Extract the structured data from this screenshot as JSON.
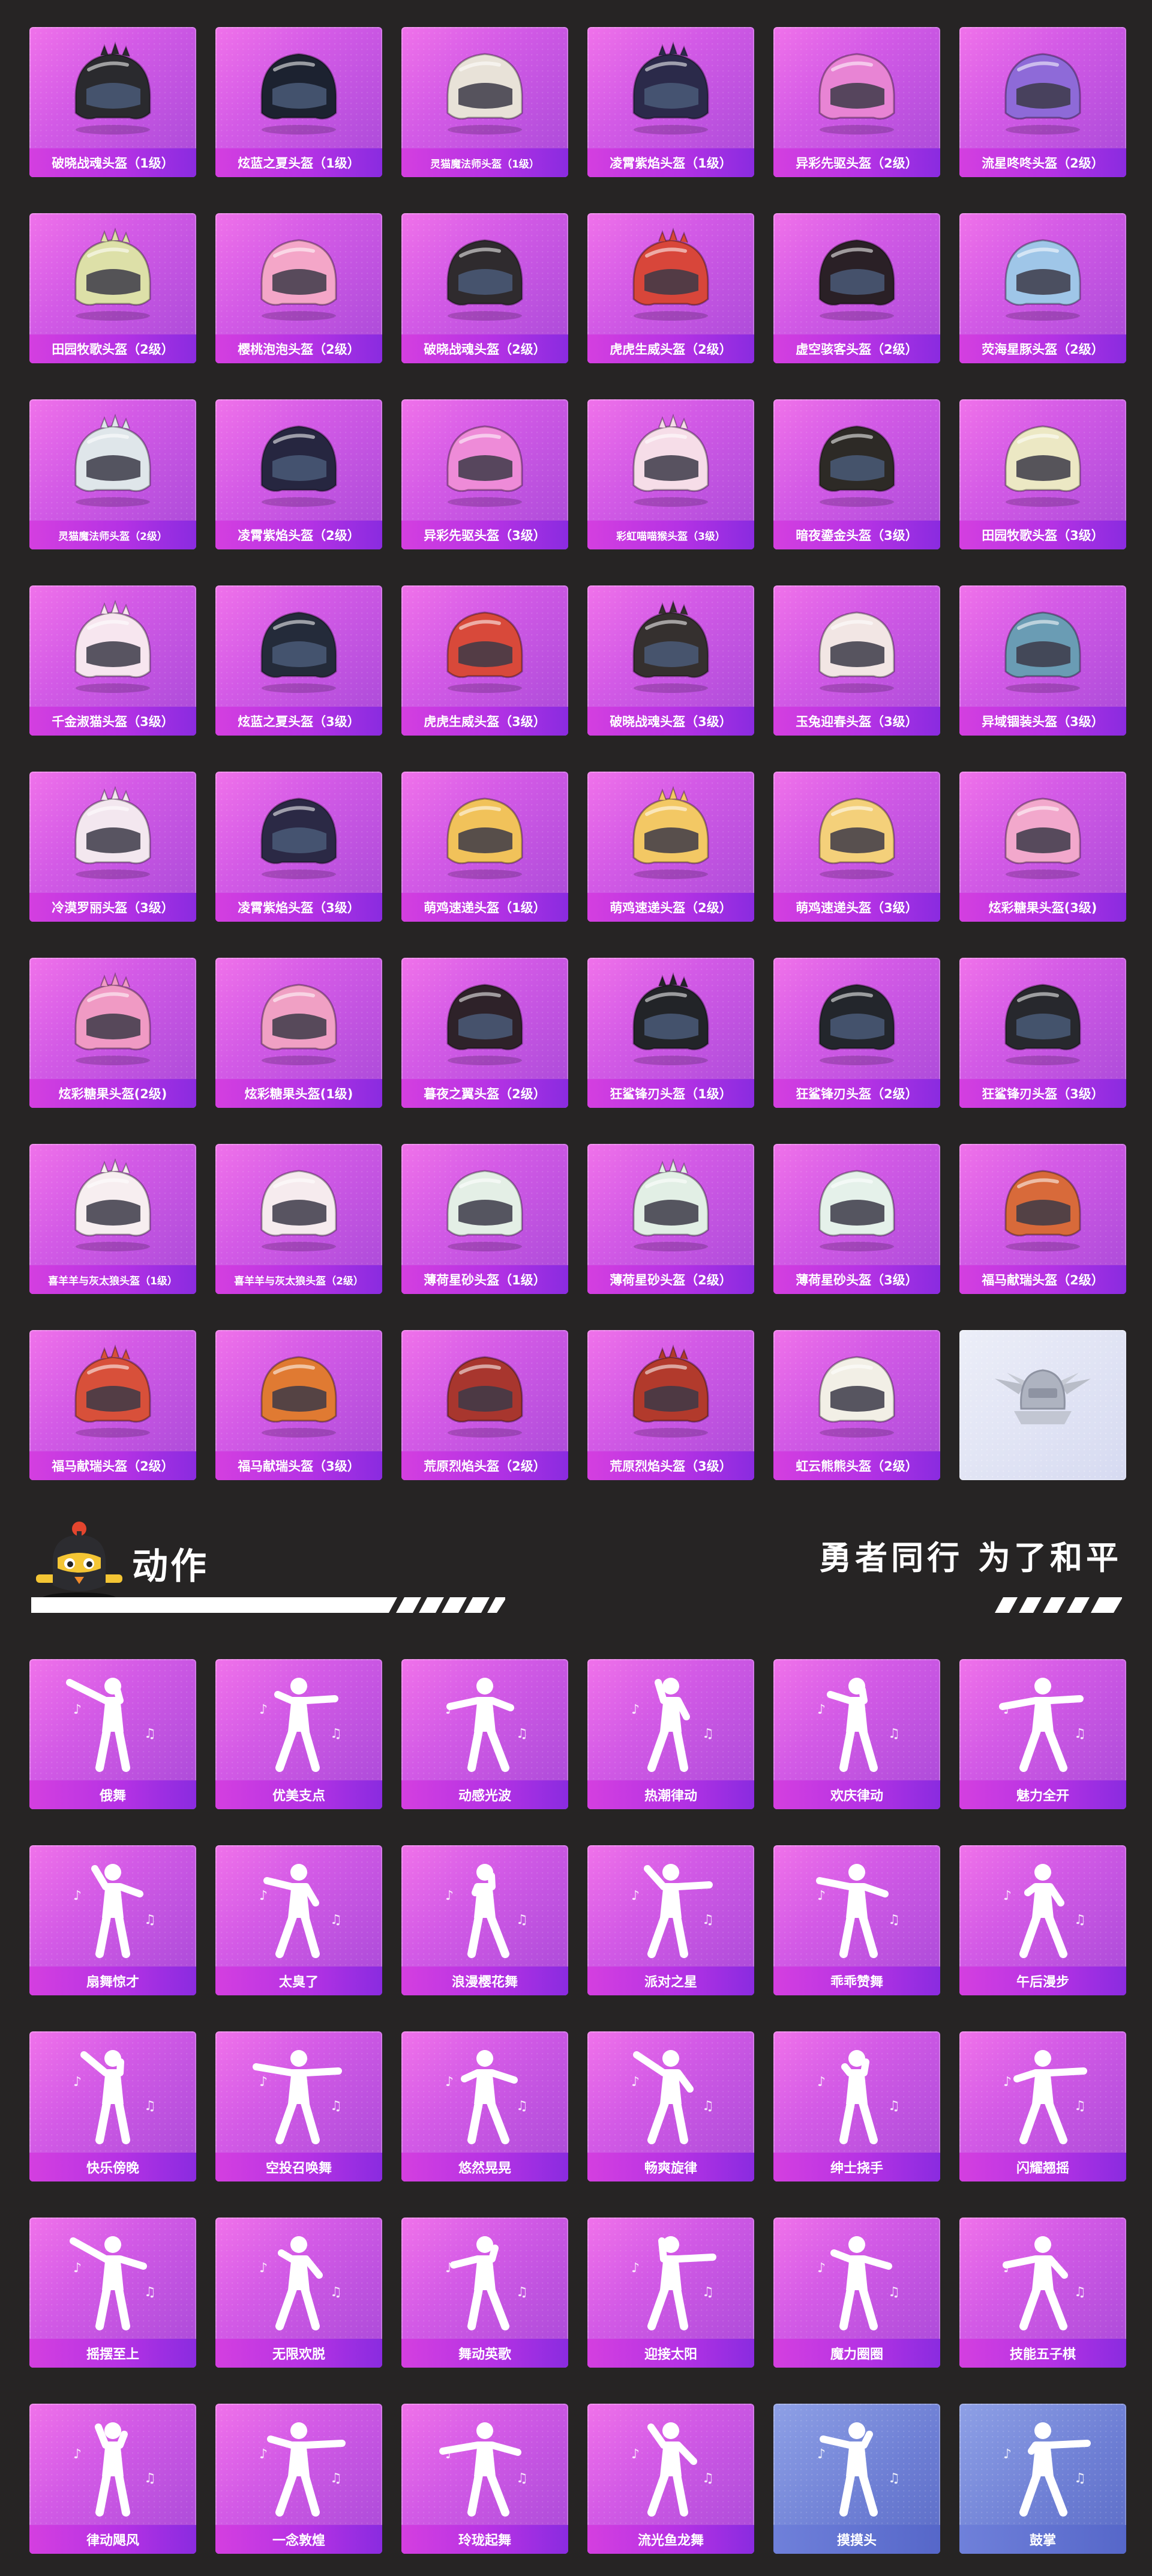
{
  "helmets": [
    {
      "label": "破晓战魂头盔（1级）",
      "color": "#2a2a2e"
    },
    {
      "label": "炫蓝之夏头盔（1级）",
      "color": "#1c2230"
    },
    {
      "label": "灵猫魔法师头盔（1级）",
      "color": "#e8e2d8"
    },
    {
      "label": "凌霄紫焰头盔（1级）",
      "color": "#2b2a4a"
    },
    {
      "label": "异彩先驱头盔（2级）",
      "color": "#e884d4"
    },
    {
      "label": "流星咚咚头盔（2级）",
      "color": "#8e6ad8"
    },
    {
      "label": "田园牧歌头盔（2级）",
      "color": "#dde0a8"
    },
    {
      "label": "樱桃泡泡头盔（2级）",
      "color": "#f4a6c8"
    },
    {
      "label": "破晓战魂头盔（2级）",
      "color": "#2f2b2e"
    },
    {
      "label": "虎虎生威头盔（2级）",
      "color": "#d8463a"
    },
    {
      "label": "虚空骇客头盔（2级）",
      "color": "#2a2026"
    },
    {
      "label": "荧海星豚头盔（2级）",
      "color": "#9fc6e8"
    },
    {
      "label": "灵猫魔法师头盔（2级）",
      "color": "#dfe6ea"
    },
    {
      "label": "凌霄紫焰头盔（2级）",
      "color": "#262640"
    },
    {
      "label": "异彩先驱头盔（3级）",
      "color": "#ee8bd8"
    },
    {
      "label": "彩虹喵喵猴头盔（3级）",
      "color": "#f6dde8"
    },
    {
      "label": "暗夜鎏金头盔（3级）",
      "color": "#2d2a26"
    },
    {
      "label": "田园牧歌头盔（3级）",
      "color": "#ece8c4"
    },
    {
      "label": "千金淑猫头盔（3级）",
      "color": "#f7e6ef"
    },
    {
      "label": "炫蓝之夏头盔（3级）",
      "color": "#242b3a"
    },
    {
      "label": "虎虎生威头盔（3级）",
      "color": "#d8493a"
    },
    {
      "label": "破晓战魂头盔（3级）",
      "color": "#35302f"
    },
    {
      "label": "玉兔迎春头盔（3级）",
      "color": "#f2e6e4"
    },
    {
      "label": "异域锢装头盔（3级）",
      "color": "#6a9cb4"
    },
    {
      "label": "冷漠罗丽头盔（3级）",
      "color": "#f3e7ef"
    },
    {
      "label": "凌霄紫焰头盔（3级）",
      "color": "#2b2945"
    },
    {
      "label": "萌鸡速递头盔（1级）",
      "color": "#f1c25a"
    },
    {
      "label": "萌鸡速递头盔（2级）",
      "color": "#f3c864"
    },
    {
      "label": "萌鸡速递头盔（3级）",
      "color": "#f4d07a"
    },
    {
      "label": "炫彩糖果头盔(3级)",
      "color": "#f2a8cc"
    },
    {
      "label": "炫彩糖果头盔(2级)",
      "color": "#f09ac4"
    },
    {
      "label": "炫彩糖果头盔(1级)",
      "color": "#f0a0c4"
    },
    {
      "label": "暮夜之翼头盔（2级）",
      "color": "#2e2229"
    },
    {
      "label": "狂鲨锋刃头盔（1级）",
      "color": "#222428"
    },
    {
      "label": "狂鲨锋刃头盔（2级）",
      "color": "#23262c"
    },
    {
      "label": "狂鲨锋刃头盔（3级）",
      "color": "#27282d"
    },
    {
      "label": "喜羊羊与灰太狼头盔（1级）",
      "color": "#f7eef0"
    },
    {
      "label": "喜羊羊与灰太狼头盔（2级）",
      "color": "#f6ebee"
    },
    {
      "label": "薄荷星砂头盔（1级）",
      "color": "#e4efe6"
    },
    {
      "label": "薄荷星砂头盔（2级）",
      "color": "#e2efe5"
    },
    {
      "label": "薄荷星砂头盔（3级）",
      "color": "#e5f1ea"
    },
    {
      "label": "福马献瑞头盔（2级）",
      "color": "#d86a3a"
    },
    {
      "label": "福马献瑞头盔（2级）",
      "color": "#d8503a"
    },
    {
      "label": "福马献瑞头盔（3级）",
      "color": "#e07a32"
    },
    {
      "label": "荒原烈焰头盔（2级）",
      "color": "#a8362e"
    },
    {
      "label": "荒原烈焰头盔（3级）",
      "color": "#b23a2c"
    },
    {
      "label": "虹云熊熊头盔（2级）",
      "color": "#f2efe6"
    },
    {
      "label": "",
      "color": "#c8ccd8"
    }
  ],
  "emote_section": {
    "title": "动作",
    "slogan": "勇者同行 为了和平"
  },
  "emotes": [
    {
      "label": "俄舞"
    },
    {
      "label": "优美支点"
    },
    {
      "label": "动感光波"
    },
    {
      "label": "热潮律动"
    },
    {
      "label": "欢庆律动"
    },
    {
      "label": "魅力全开"
    },
    {
      "label": "扇舞惊才"
    },
    {
      "label": "太臭了"
    },
    {
      "label": "浪漫樱花舞"
    },
    {
      "label": "派对之星"
    },
    {
      "label": "乖乖赞舞"
    },
    {
      "label": "午后漫步"
    },
    {
      "label": "快乐傍晚"
    },
    {
      "label": "空投召唤舞"
    },
    {
      "label": "悠然晃晃"
    },
    {
      "label": "畅爽旋律"
    },
    {
      "label": "绅士挠手"
    },
    {
      "label": "闪耀翘摇"
    },
    {
      "label": "摇摆至上"
    },
    {
      "label": "无限欢脱"
    },
    {
      "label": "舞动英歌"
    },
    {
      "label": "迎接太阳"
    },
    {
      "label": "魔力圈圈"
    },
    {
      "label": "技能五子棋"
    },
    {
      "label": "律动飓风"
    },
    {
      "label": "一念敦煌"
    },
    {
      "label": "玲珑起舞"
    },
    {
      "label": "流光鱼龙舞"
    },
    {
      "label": "摸摸头",
      "variant": "blue"
    },
    {
      "label": "鼓掌",
      "variant": "blue"
    }
  ]
}
